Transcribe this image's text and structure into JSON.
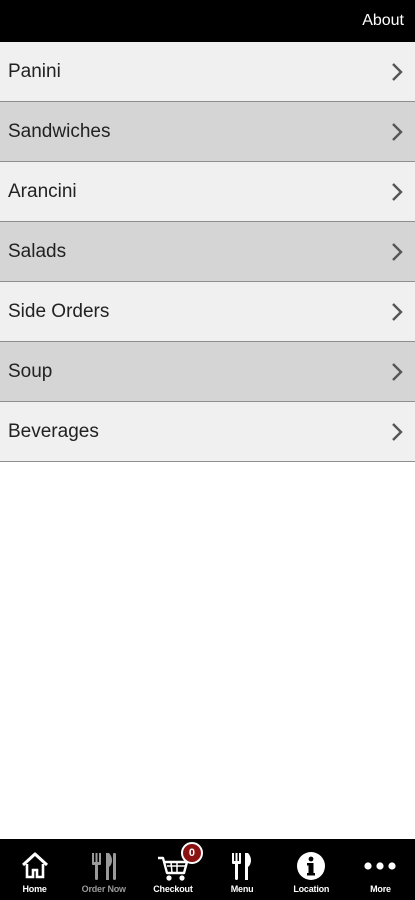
{
  "header": {
    "about_label": "About"
  },
  "menu": {
    "items": [
      {
        "label": "Panini"
      },
      {
        "label": "Sandwiches"
      },
      {
        "label": "Arancini"
      },
      {
        "label": "Salads"
      },
      {
        "label": "Side Orders"
      },
      {
        "label": "Soup"
      },
      {
        "label": "Beverages"
      }
    ]
  },
  "tabbar": {
    "tabs": [
      {
        "label": "Home",
        "icon": "home-icon"
      },
      {
        "label": "Order Now",
        "icon": "cutlery-icon"
      },
      {
        "label": "Checkout",
        "icon": "cart-icon",
        "badge": "0"
      },
      {
        "label": "Menu",
        "icon": "fork-knife-icon"
      },
      {
        "label": "Location",
        "icon": "info-icon"
      },
      {
        "label": "More",
        "icon": "ellipsis-icon"
      }
    ]
  },
  "colors": {
    "topbar": "#000000",
    "row_light": "#f0f0f0",
    "row_dark": "#d5d5d5",
    "badge": "#8a1212"
  }
}
